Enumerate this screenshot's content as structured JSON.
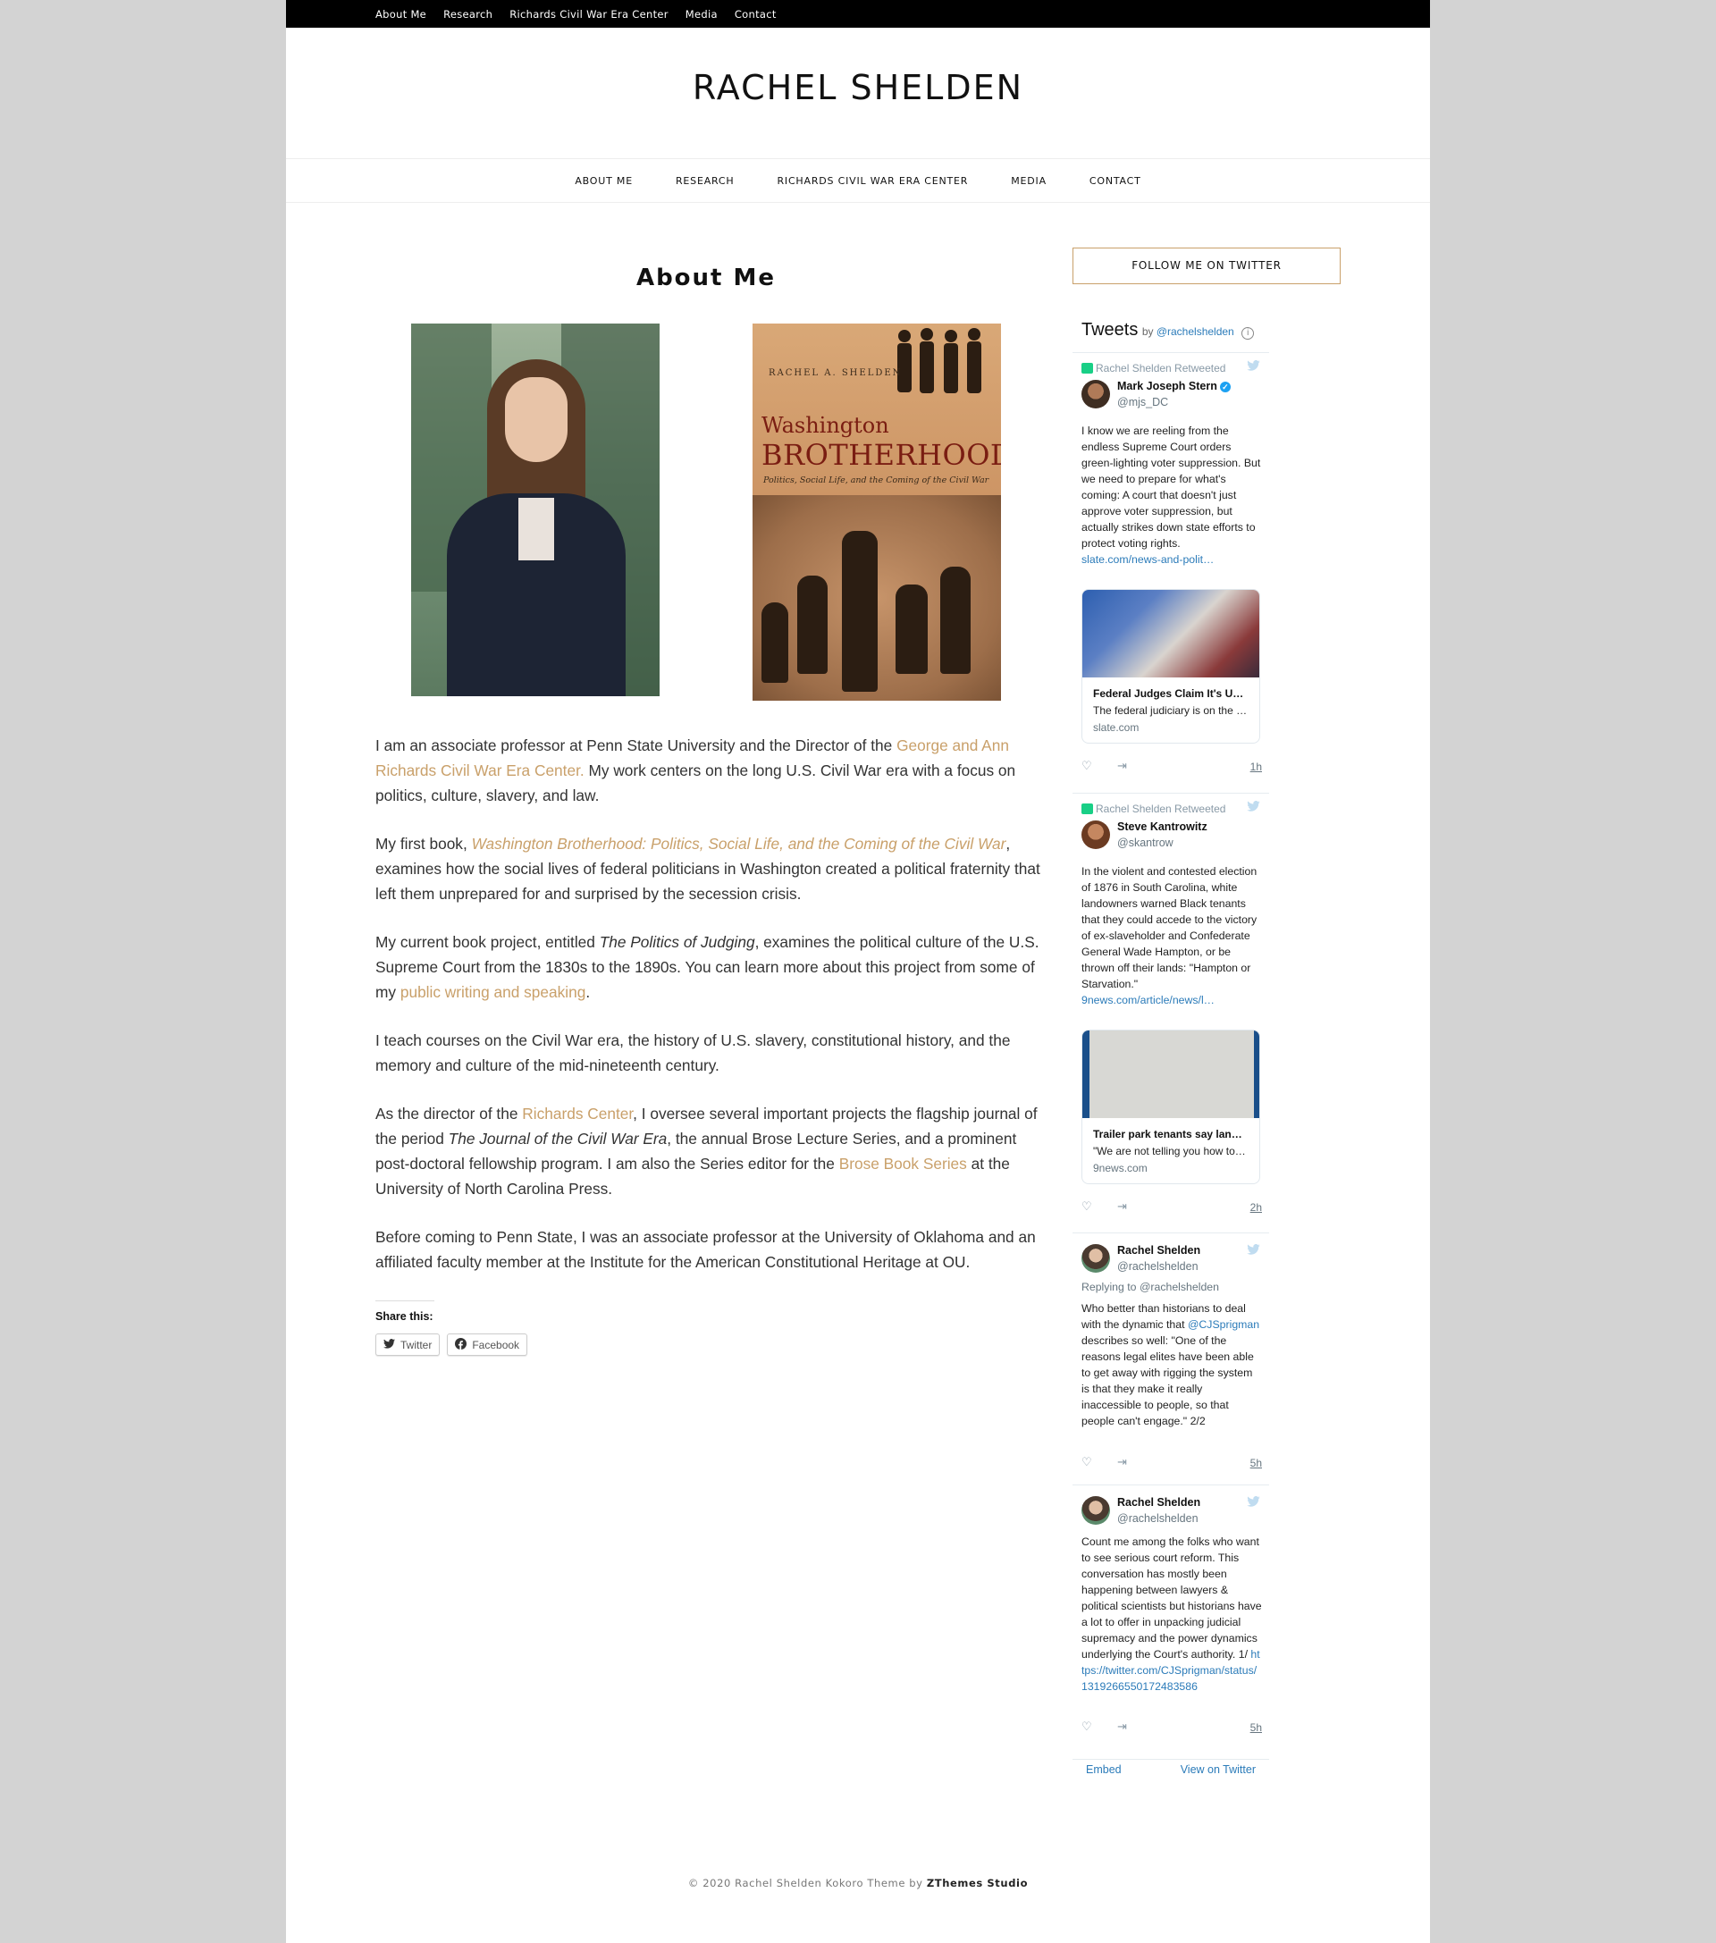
{
  "topbar": {
    "items": [
      "About Me",
      "Research",
      "Richards Civil War Era Center",
      "Media",
      "Contact"
    ]
  },
  "site": {
    "title": "RACHEL SHELDEN"
  },
  "mainnav": {
    "items": [
      "ABOUT ME",
      "RESEARCH",
      "RICHARDS CIVIL WAR ERA CENTER",
      "MEDIA",
      "CONTACT"
    ]
  },
  "page": {
    "title": "About Me"
  },
  "book_cover": {
    "author": "RACHEL A. SHELDEN",
    "title_line1": "Washington",
    "title_line2": "BROTHERHOOD",
    "subtitle": "Politics, Social Life, and the Coming of the Civil War"
  },
  "content": {
    "p1_a": "I am an associate professor at Penn State University and the Director of the ",
    "p1_link": "George and Ann Richards Civil War Era Center.",
    "p1_b": " My work centers on the long U.S. Civil War era with a focus on politics, culture, slavery, and law.",
    "p2_a": "My first book, ",
    "p2_link": "Washington Brotherhood: Politics, Social Life, and the Coming of the Civil War",
    "p2_b": ", examines how the social lives of federal politicians in Washington created a political fraternity that left them unprepared for and surprised by the secession crisis.",
    "p3_a": "My current book project, entitled ",
    "p3_em": "The Politics of Judging",
    "p3_b": ", examines the political culture of the U.S. Supreme Court from the 1830s to the 1890s. You can learn more about this project from some of my ",
    "p3_link": "public writing and speaking",
    "p3_c": ".",
    "p4": "I teach courses on the Civil War era, the history of U.S. slavery, constitutional history, and the memory and culture of the mid-nineteenth century.",
    "p5_a": "As the director of the ",
    "p5_link1": "Richards Center",
    "p5_b": ", I oversee several important projects the flagship journal of the period ",
    "p5_em": "The Journal of the Civil War Era",
    "p5_c": ", the annual Brose Lecture Series, and a prominent post-doctoral fellowship program. I am also the Series editor for the ",
    "p5_link2": "Brose Book Series",
    "p5_d": " at the University of North Carolina Press.",
    "p6": "Before coming to Penn State, I was an associate professor at the University of Oklahoma and an affiliated faculty member at the Institute for the American Constitutional Heritage at OU."
  },
  "share": {
    "heading": "Share this:",
    "twitter": "Twitter",
    "facebook": "Facebook"
  },
  "sidebar": {
    "follow": "FOLLOW ME ON TWITTER"
  },
  "twitter": {
    "title": "Tweets",
    "by": "by ",
    "by_handle": "@rachelshelden",
    "info": "i",
    "tweets": [
      {
        "retweet_label": "Rachel Shelden Retweeted",
        "name": "Mark Joseph Stern",
        "handle": "@mjs_DC",
        "text": "I know we are reeling from the endless Supreme Court orders green-lighting voter suppression. But we need to prepare for what's coming: A court that doesn't just approve voter suppression, but actually strikes down state efforts to protect voting rights. ",
        "link": "slate.com/news-and-polit…",
        "card_title": "Federal Judges Claim It's Unc…",
        "card_desc": "The federal judiciary is on the …",
        "card_domain": "slate.com",
        "time": "1h"
      },
      {
        "retweet_label": "Rachel Shelden Retweeted",
        "name": "Steve Kantrowitz",
        "handle": "@skantrow",
        "text": "In the violent and contested election of 1876 in South Carolina, white landowners warned Black tenants that they could accede to the victory of ex-slaveholder and Confederate General Wade Hampton, or be thrown off their lands:  \"Hampton or Starvation.\"",
        "link": "9news.com/article/news/l…",
        "card_title": "Trailer park tenants say lan…",
        "card_desc": "\"We are not telling you how to…",
        "card_domain": "9news.com",
        "time": "2h"
      },
      {
        "name": "Rachel Shelden",
        "handle": "@rachelshelden",
        "reply_prefix": "Replying to ",
        "reply_handle": "@rachelshelden",
        "text_a": "Who better than historians to deal with the dynamic that ",
        "mention": "@CJSprigman",
        "text_b": " describes so well: \"One of the reasons legal elites have been able to get away with rigging the system is that they make it really inaccessible to people, so that people can't engage.\" 2/2",
        "time": "5h"
      },
      {
        "name": "Rachel Shelden",
        "handle": "@rachelshelden",
        "text": "Count me among the folks who want to see serious court reform. This conversation has mostly been happening between lawyers & political scientists but historians have a lot to offer in unpacking judicial supremacy and the power dynamics underlying the Court's authority. 1/ ",
        "link": "https://twitter.com/CJSprigman/status/1319266550172483586",
        "time": "5h"
      }
    ],
    "embed": "Embed",
    "view_on": "View on Twitter"
  },
  "footer": {
    "copyright": "© 2020 Rachel Shelden Kokoro Theme by ",
    "studio": "ZThemes Studio"
  },
  "colors": {
    "accent": "#c9a06a",
    "twitter_link": "#2b7bb9",
    "topbar": "#000000"
  }
}
